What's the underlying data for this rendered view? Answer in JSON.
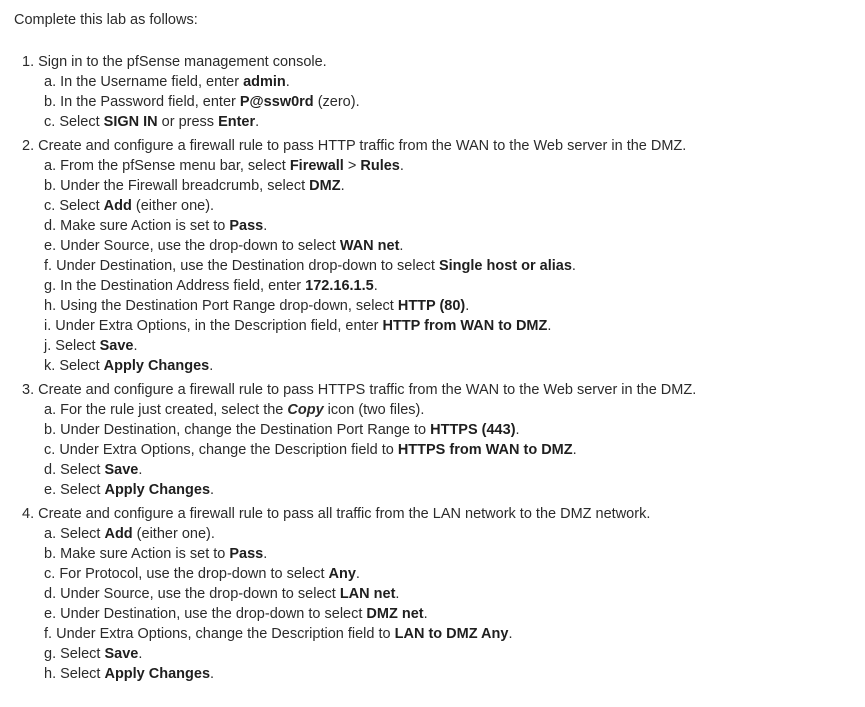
{
  "intro": "Complete this lab as follows:",
  "steps": [
    {
      "num": "1.",
      "text": [
        {
          "t": "Sign in to the pfSense management console."
        }
      ],
      "subs": [
        {
          "letter": "a.",
          "text": [
            {
              "t": "In the Username field, enter "
            },
            {
              "t": "admin",
              "b": true
            },
            {
              "t": "."
            }
          ]
        },
        {
          "letter": "b.",
          "text": [
            {
              "t": "In the Password field, enter "
            },
            {
              "t": "P@ssw0rd",
              "b": true
            },
            {
              "t": " (zero)."
            }
          ]
        },
        {
          "letter": "c.",
          "text": [
            {
              "t": "Select "
            },
            {
              "t": "SIGN IN",
              "b": true
            },
            {
              "t": " or press "
            },
            {
              "t": "Enter",
              "b": true
            },
            {
              "t": "."
            }
          ]
        }
      ]
    },
    {
      "num": "2.",
      "text": [
        {
          "t": "Create and configure a firewall rule to pass HTTP traffic from the WAN to the Web server in the DMZ."
        }
      ],
      "subs": [
        {
          "letter": "a.",
          "text": [
            {
              "t": "From the pfSense menu bar, select "
            },
            {
              "t": "Firewall",
              "b": true
            },
            {
              "t": " > "
            },
            {
              "t": "Rules",
              "b": true
            },
            {
              "t": "."
            }
          ]
        },
        {
          "letter": "b.",
          "text": [
            {
              "t": "Under the Firewall breadcrumb, select "
            },
            {
              "t": "DMZ",
              "b": true
            },
            {
              "t": "."
            }
          ]
        },
        {
          "letter": "c.",
          "text": [
            {
              "t": "Select "
            },
            {
              "t": "Add",
              "b": true
            },
            {
              "t": " (either one)."
            }
          ]
        },
        {
          "letter": "d.",
          "text": [
            {
              "t": "Make sure Action is set to "
            },
            {
              "t": "Pass",
              "b": true
            },
            {
              "t": "."
            }
          ]
        },
        {
          "letter": "e.",
          "text": [
            {
              "t": "Under Source, use the drop-down to select "
            },
            {
              "t": "WAN net",
              "b": true
            },
            {
              "t": "."
            }
          ]
        },
        {
          "letter": "f.",
          "text": [
            {
              "t": "Under Destination, use the Destination drop-down to select "
            },
            {
              "t": "Single host or alias",
              "b": true
            },
            {
              "t": "."
            }
          ]
        },
        {
          "letter": "g.",
          "text": [
            {
              "t": "In the Destination Address field, enter "
            },
            {
              "t": "172.16.1.5",
              "b": true
            },
            {
              "t": "."
            }
          ]
        },
        {
          "letter": "h.",
          "text": [
            {
              "t": "Using the Destination Port Range drop-down, select "
            },
            {
              "t": "HTTP (80)",
              "b": true
            },
            {
              "t": "."
            }
          ]
        },
        {
          "letter": "i.",
          "text": [
            {
              "t": "Under Extra Options, in the Description field, enter "
            },
            {
              "t": "HTTP from WAN to DMZ",
              "b": true
            },
            {
              "t": "."
            }
          ]
        },
        {
          "letter": "j.",
          "text": [
            {
              "t": "Select "
            },
            {
              "t": "Save",
              "b": true
            },
            {
              "t": "."
            }
          ]
        },
        {
          "letter": "k.",
          "text": [
            {
              "t": "Select "
            },
            {
              "t": "Apply Changes",
              "b": true
            },
            {
              "t": "."
            }
          ]
        }
      ]
    },
    {
      "num": "3.",
      "text": [
        {
          "t": "Create and configure a firewall rule to pass HTTPS traffic from the WAN to the Web server in the DMZ."
        }
      ],
      "subs": [
        {
          "letter": "a.",
          "text": [
            {
              "t": "For the rule just created, select the "
            },
            {
              "t": "Copy",
              "b": true,
              "i": true
            },
            {
              "t": " icon (two files)."
            }
          ]
        },
        {
          "letter": "b.",
          "text": [
            {
              "t": "Under Destination, change the Destination Port Range to "
            },
            {
              "t": "HTTPS (443)",
              "b": true
            },
            {
              "t": "."
            }
          ]
        },
        {
          "letter": "c.",
          "text": [
            {
              "t": "Under Extra Options, change the Description field to "
            },
            {
              "t": "HTTPS from WAN to DMZ",
              "b": true
            },
            {
              "t": "."
            }
          ]
        },
        {
          "letter": "d.",
          "text": [
            {
              "t": "Select "
            },
            {
              "t": "Save",
              "b": true
            },
            {
              "t": "."
            }
          ]
        },
        {
          "letter": "e.",
          "text": [
            {
              "t": "Select "
            },
            {
              "t": "Apply Changes",
              "b": true
            },
            {
              "t": "."
            }
          ]
        }
      ]
    },
    {
      "num": "4.",
      "text": [
        {
          "t": "Create and configure a firewall rule to pass all traffic from the LAN network to the DMZ network."
        }
      ],
      "subs": [
        {
          "letter": "a.",
          "text": [
            {
              "t": "Select "
            },
            {
              "t": "Add",
              "b": true
            },
            {
              "t": " (either one)."
            }
          ]
        },
        {
          "letter": "b.",
          "text": [
            {
              "t": "Make sure Action is set to "
            },
            {
              "t": "Pass",
              "b": true
            },
            {
              "t": "."
            }
          ]
        },
        {
          "letter": "c.",
          "text": [
            {
              "t": "For Protocol, use the drop-down to select "
            },
            {
              "t": "Any",
              "b": true
            },
            {
              "t": "."
            }
          ]
        },
        {
          "letter": "d.",
          "text": [
            {
              "t": "Under Source, use the drop-down to select "
            },
            {
              "t": "LAN net",
              "b": true
            },
            {
              "t": "."
            }
          ]
        },
        {
          "letter": "e.",
          "text": [
            {
              "t": "Under Destination, use the drop-down to select "
            },
            {
              "t": "DMZ net",
              "b": true
            },
            {
              "t": "."
            }
          ]
        },
        {
          "letter": "f.",
          "text": [
            {
              "t": "Under Extra Options, change the Description field to "
            },
            {
              "t": "LAN to DMZ Any",
              "b": true
            },
            {
              "t": "."
            }
          ]
        },
        {
          "letter": "g.",
          "text": [
            {
              "t": "Select "
            },
            {
              "t": "Save",
              "b": true
            },
            {
              "t": "."
            }
          ]
        },
        {
          "letter": "h.",
          "text": [
            {
              "t": "Select "
            },
            {
              "t": "Apply Changes",
              "b": true
            },
            {
              "t": "."
            }
          ]
        }
      ]
    }
  ]
}
